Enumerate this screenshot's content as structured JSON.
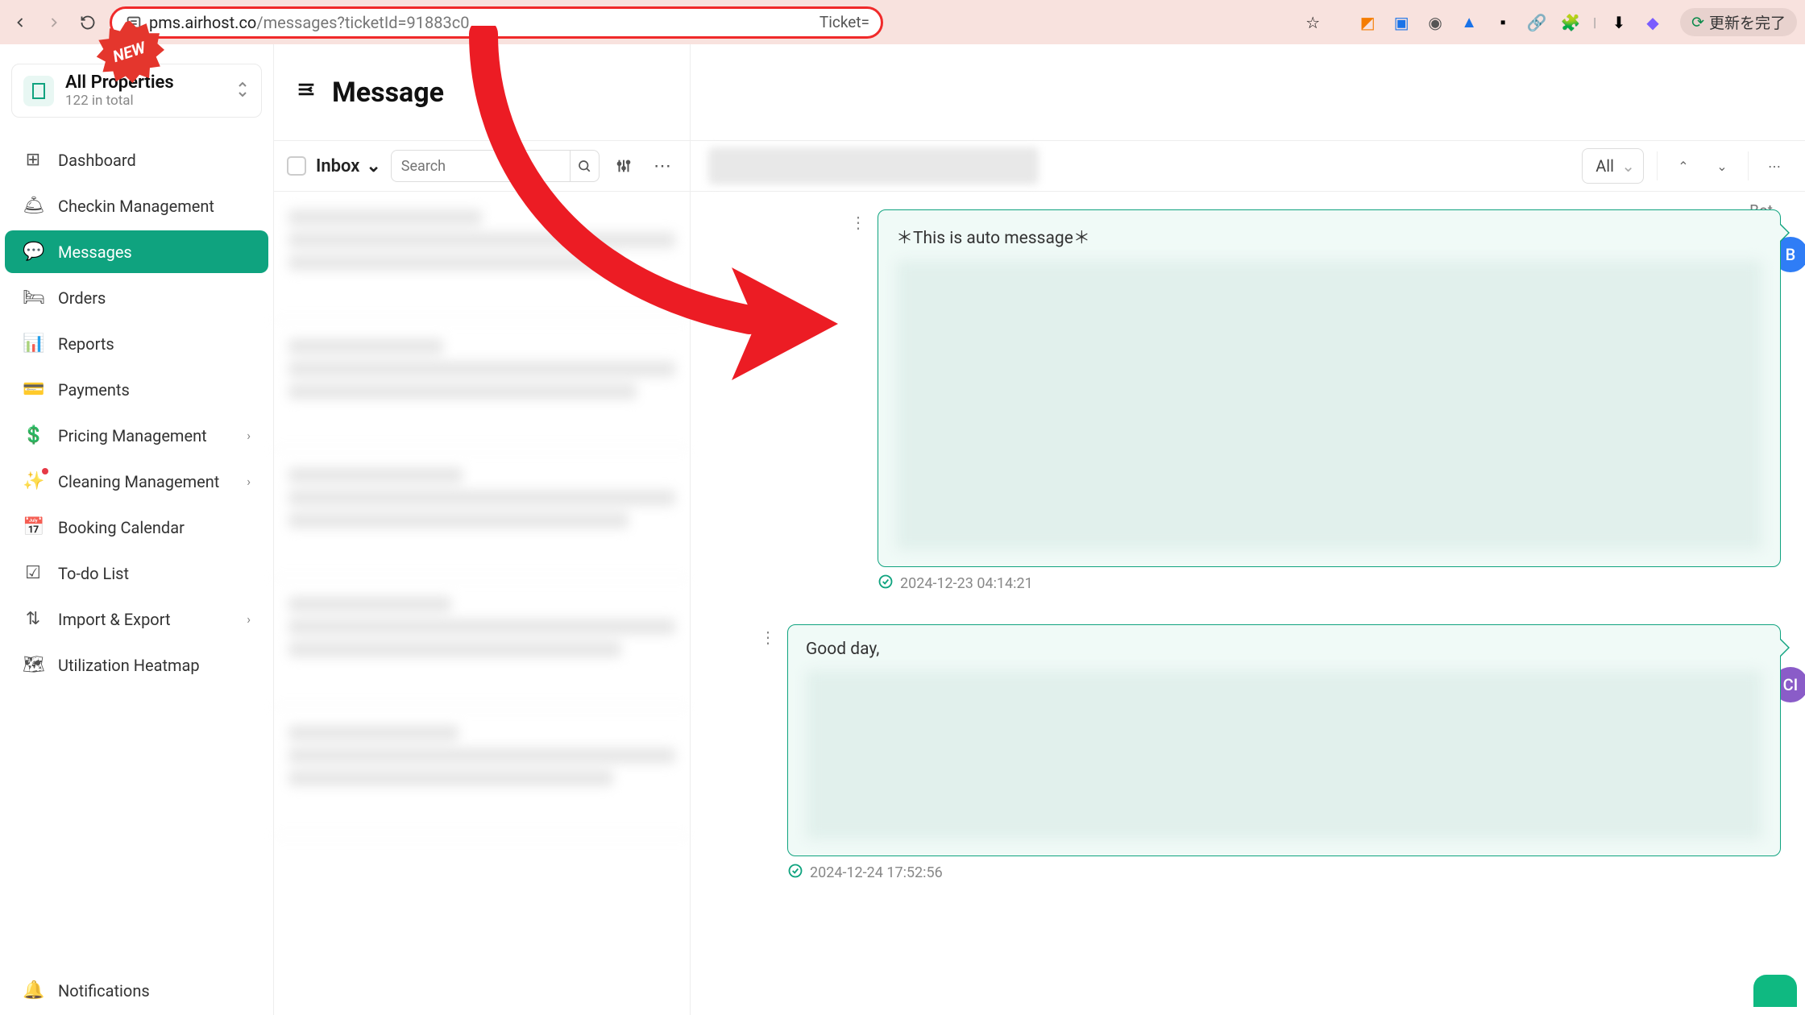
{
  "browser": {
    "url_host": "pms.airhost.co",
    "url_path": "/messages?ticketId=91883c0",
    "ticket_token": "Ticket=",
    "update_pill": "更新を完了"
  },
  "badge": {
    "text": "NEW"
  },
  "property_selector": {
    "title": "All Properties",
    "subtitle": "122 in total"
  },
  "sidebar": {
    "items": [
      {
        "icon": "⊞",
        "label": "Dashboard",
        "sub": false
      },
      {
        "icon": "🛎",
        "label": "Checkin Management",
        "sub": false
      },
      {
        "icon": "💬",
        "label": "Messages",
        "sub": false,
        "active": true
      },
      {
        "icon": "🛏",
        "label": "Orders",
        "sub": false
      },
      {
        "icon": "📊",
        "label": "Reports",
        "sub": false
      },
      {
        "icon": "💳",
        "label": "Payments",
        "sub": false
      },
      {
        "icon": "💲",
        "label": "Pricing Management",
        "sub": true
      },
      {
        "icon": "✨",
        "label": "Cleaning Management",
        "sub": true,
        "dot": true
      },
      {
        "icon": "📅",
        "label": "Booking Calendar",
        "sub": false
      },
      {
        "icon": "☑",
        "label": "To-do List",
        "sub": false
      },
      {
        "icon": "⇅",
        "label": "Import & Export",
        "sub": true
      },
      {
        "icon": "🗺",
        "label": "Utilization Heatmap",
        "sub": false
      }
    ],
    "footer": {
      "icon": "🔔",
      "label": "Notifications"
    }
  },
  "page": {
    "title": "Message"
  },
  "list_toolbar": {
    "folder": "Inbox",
    "search_placeholder": "Search"
  },
  "thread_toolbar": {
    "filter": "All"
  },
  "thread": {
    "sender_label_1": "Bot",
    "avatar_b": "B",
    "avatar_ci": "CI",
    "msg1": {
      "text": "＊This is auto message＊",
      "timestamp": "2024-12-23 04:14:21"
    },
    "msg2": {
      "text": "Good day,",
      "timestamp": "2024-12-24 17:52:56"
    }
  }
}
